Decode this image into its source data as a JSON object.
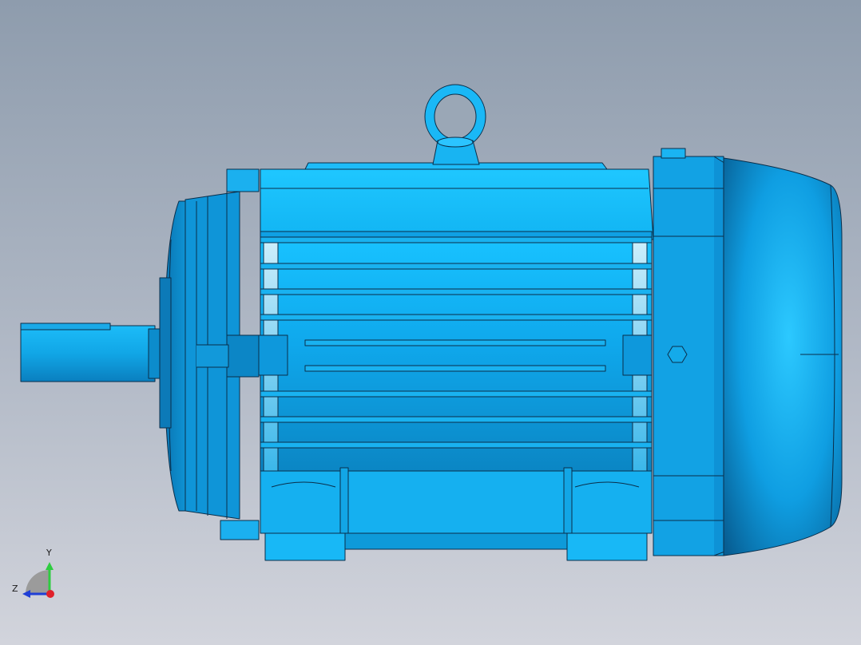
{
  "viewport": {
    "background_top": "#8e9cad",
    "background_bottom": "#d2d4dc"
  },
  "model": {
    "name": "electric-motor",
    "base_color": "#13b4f2",
    "edge_color": "#0a2e4a"
  },
  "triad": {
    "y_label": "Y",
    "z_label": "Z",
    "y_color": "#2ecc40",
    "z_color": "#1f3fd6",
    "x_color": "#e0202a"
  }
}
